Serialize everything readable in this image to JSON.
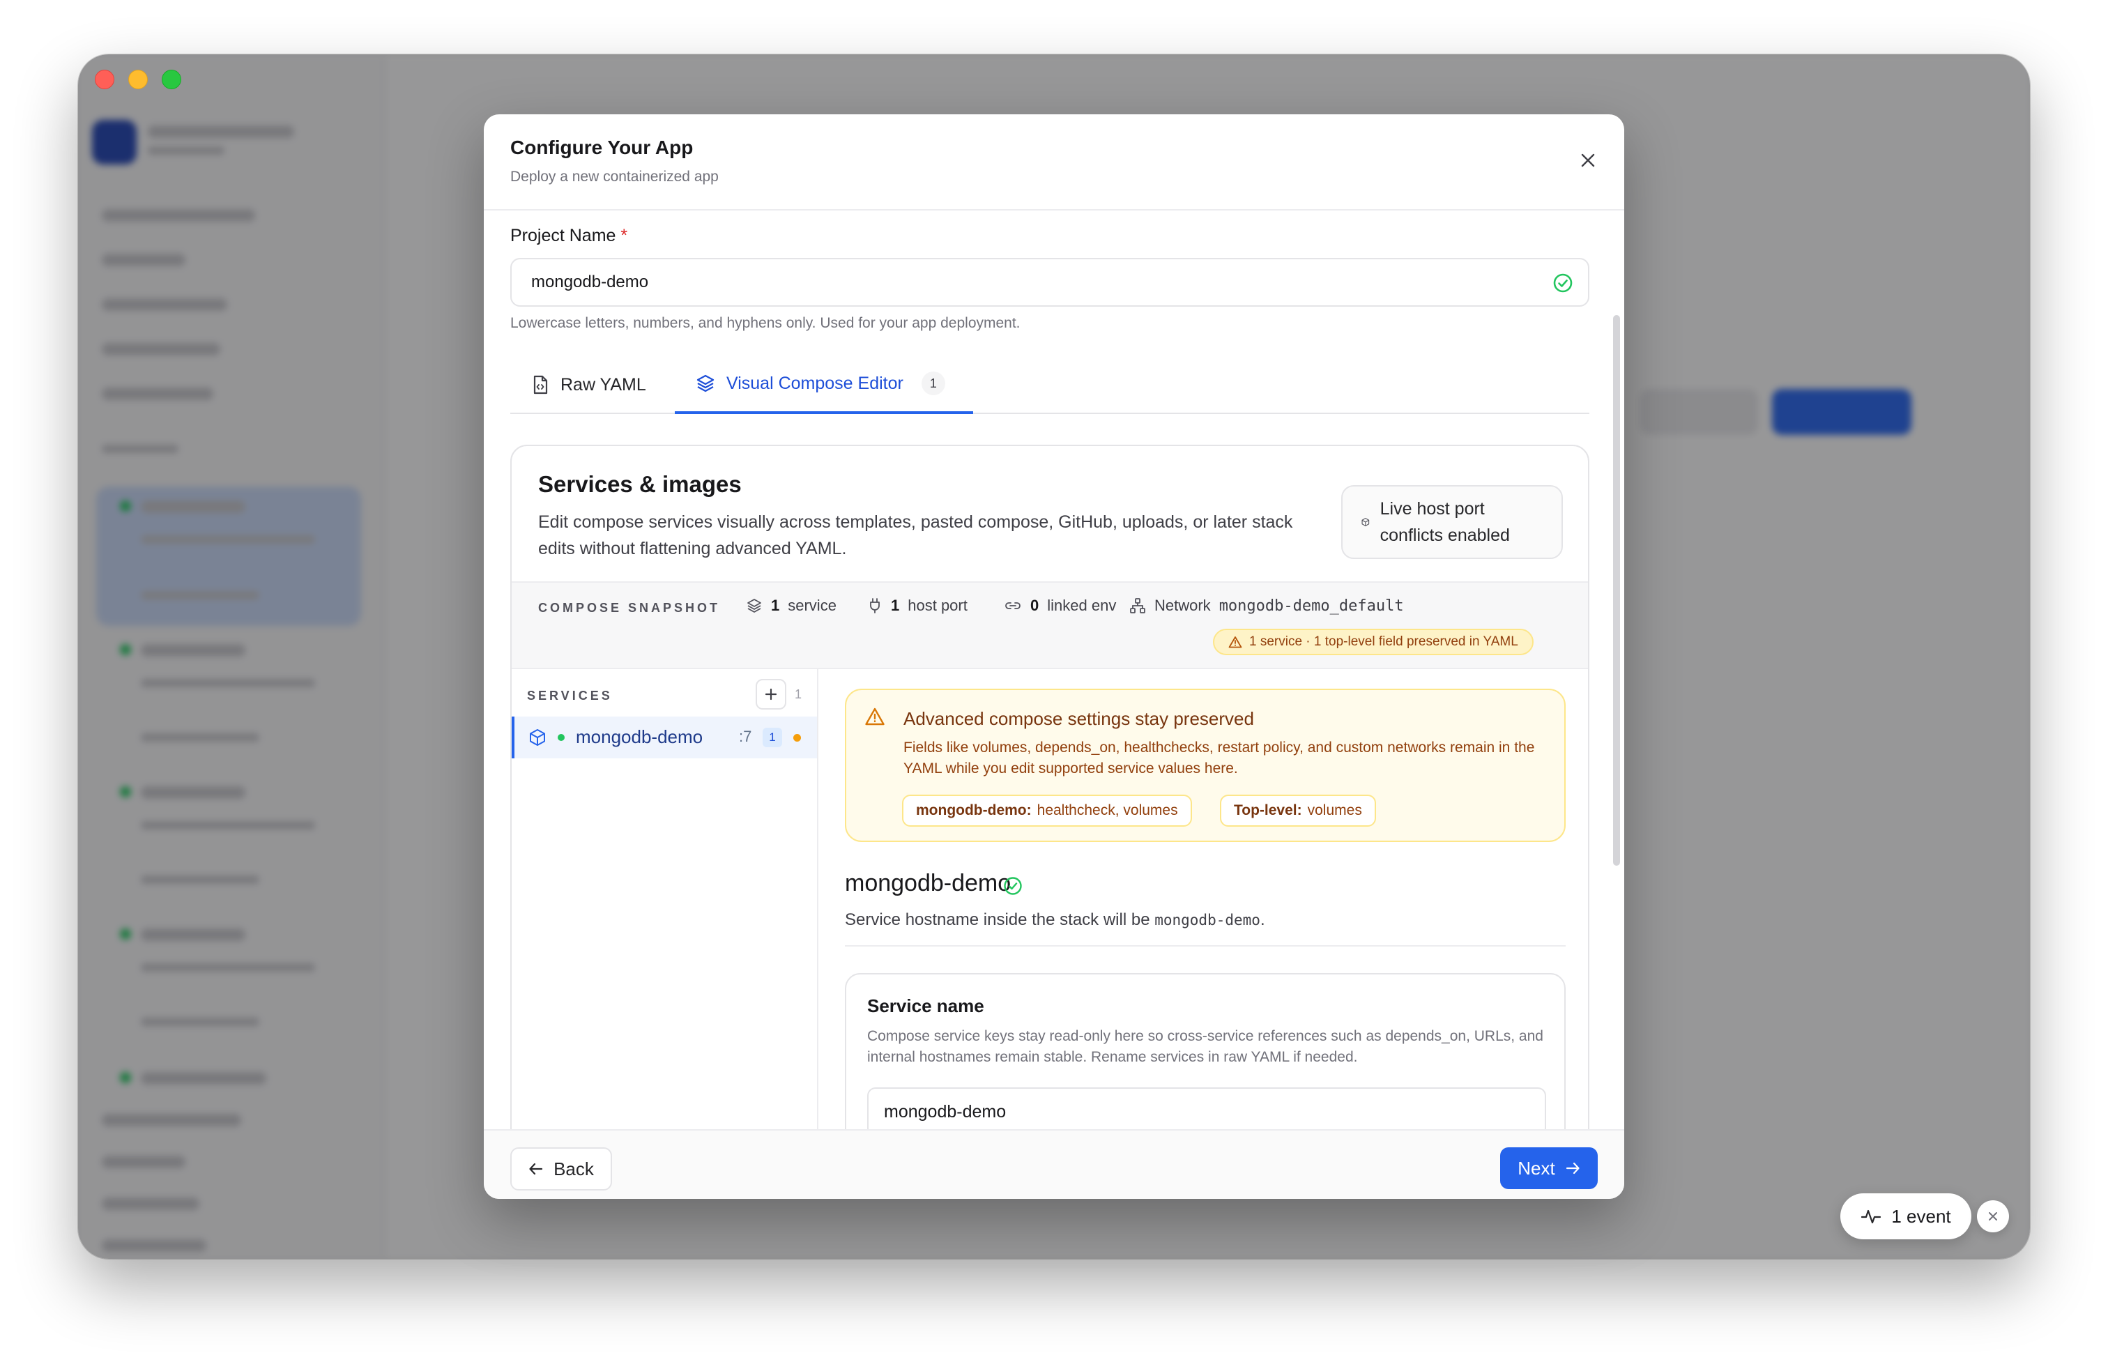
{
  "modal": {
    "title": "Configure Your App",
    "subtitle": "Deploy a new containerized app"
  },
  "project": {
    "label": "Project Name",
    "required_mark": "*",
    "value": "mongodb-demo",
    "hint": "Lowercase letters, numbers, and hyphens only. Used for your app deployment."
  },
  "tabs": [
    {
      "label": "Raw YAML",
      "icon": "file-code-icon",
      "active": false
    },
    {
      "label": "Visual Compose Editor",
      "icon": "layers-icon",
      "active": true,
      "badge": "1"
    }
  ],
  "services_card": {
    "title": "Services & images",
    "description": "Edit compose services visually across templates, pasted compose, GitHub, uploads, or later stack edits without flattening advanced YAML.",
    "live_pill": "Live host port conflicts enabled"
  },
  "snapshot": {
    "label": "COMPOSE SNAPSHOT",
    "service_count": "1",
    "service_label": "service",
    "port_count": "1",
    "port_label": "host port",
    "env_count": "0",
    "env_label": "linked env",
    "network_label": "Network",
    "network_value": "mongodb-demo_default",
    "warning": "1 service · 1 top-level field preserved in YAML"
  },
  "services_list": {
    "header": "SERVICES",
    "count": "1",
    "items": [
      {
        "name": "mongodb-demo",
        "port": ":7",
        "badge": "1",
        "status": "running"
      }
    ]
  },
  "advisory": {
    "title": "Advanced compose settings stay preserved",
    "text": "Fields like volumes, depends_on, healthchecks, restart policy, and custom networks remain in the YAML while you edit supported service values here.",
    "chips": [
      {
        "key": "mongodb-demo:",
        "value": "healthcheck, volumes"
      },
      {
        "key": "Top-level:",
        "value": "volumes"
      }
    ]
  },
  "service_detail": {
    "name": "mongodb-demo",
    "hostname_prefix": "Service hostname inside the stack will be",
    "hostname_value": "mongodb-demo",
    "hostname_suffix": "."
  },
  "service_name_card": {
    "title": "Service name",
    "description": "Compose service keys stay read-only here so cross-service references such as depends_on, URLs, and internal hostnames remain stable. Rename services in raw YAML if needed.",
    "value": "mongodb-demo"
  },
  "footer": {
    "back_label": "Back",
    "next_label": "Next"
  },
  "toast": {
    "label": "1 event"
  },
  "colors": {
    "accent": "#2563eb",
    "success": "#22c55e",
    "warning": "#f59e0b",
    "danger": "#dc2626"
  }
}
